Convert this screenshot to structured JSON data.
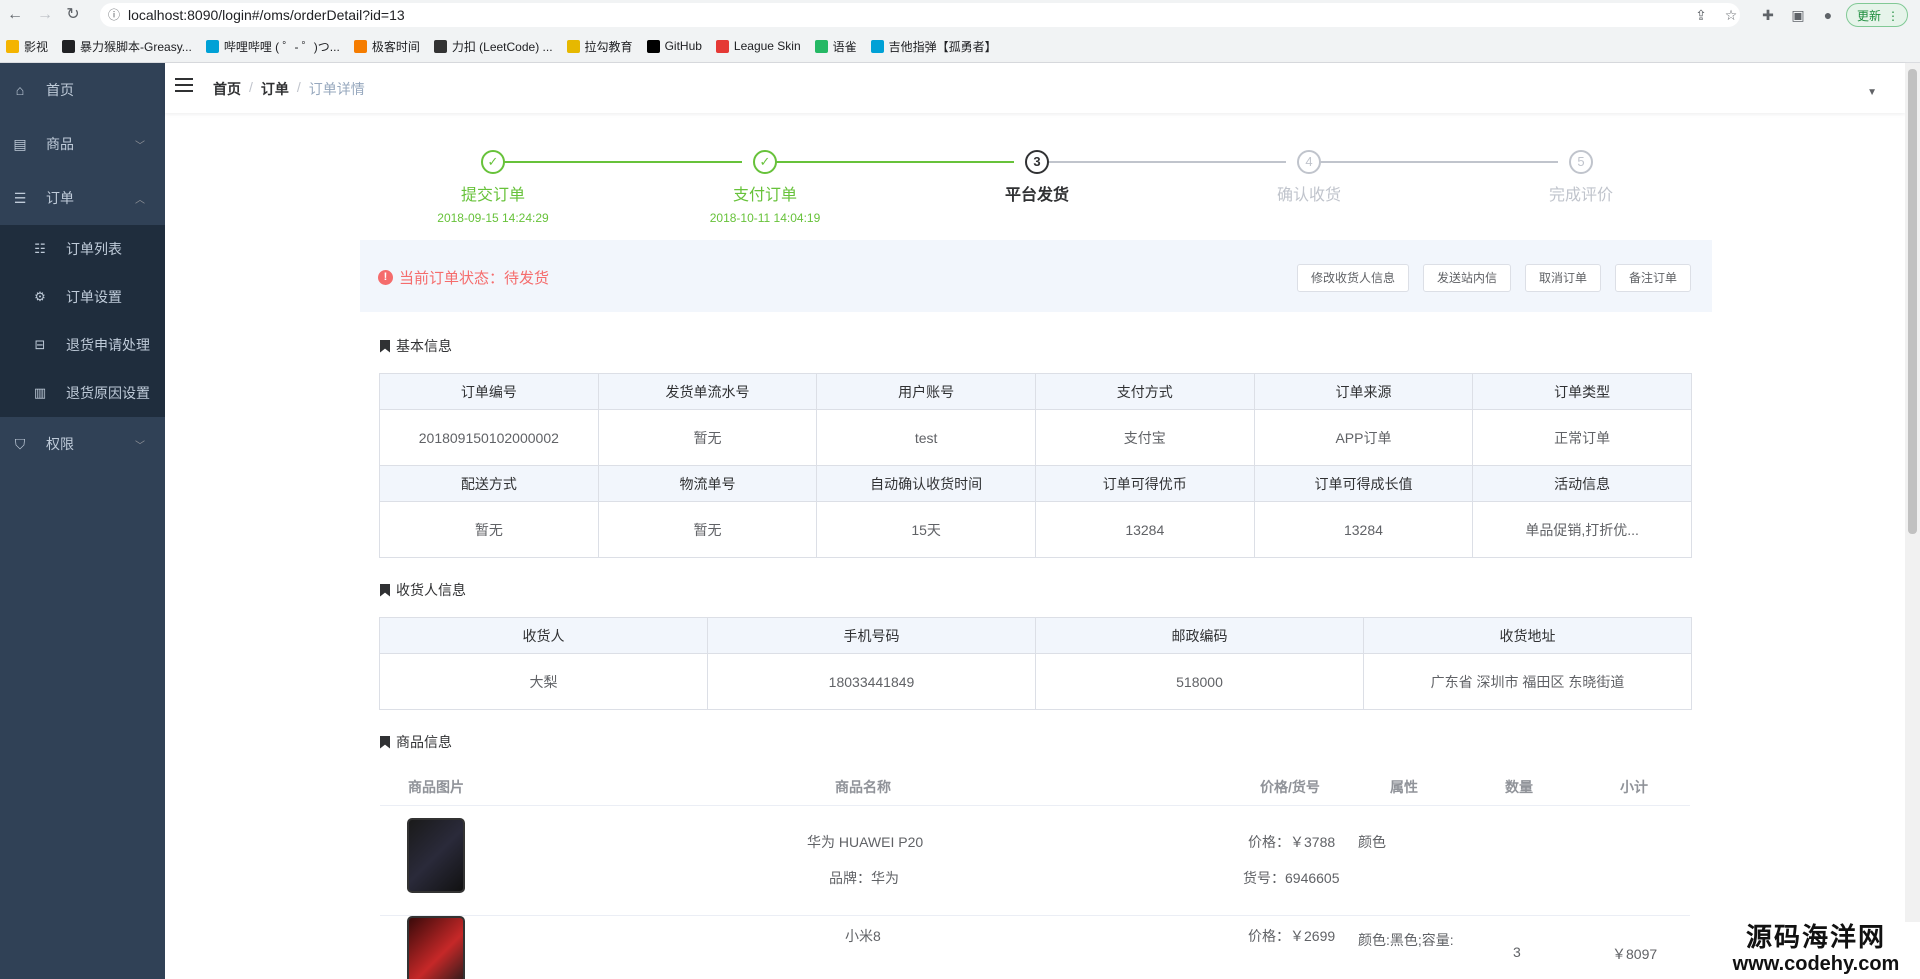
{
  "browser": {
    "url": "localhost:8090/login#/oms/orderDetail?id=13",
    "update_label": "更新",
    "bookmarks": [
      {
        "label": "影视",
        "color": "#f4b400"
      },
      {
        "label": "暴力猴脚本-Greasy...",
        "color": "#202124"
      },
      {
        "label": "哔哩哔哩 ( ゜- ゜)つ...",
        "color": "#00a1d6"
      },
      {
        "label": "极客时间",
        "color": "#f57c00"
      },
      {
        "label": "力扣 (LeetCode) ...",
        "color": "#333333"
      },
      {
        "label": "拉勾教育",
        "color": "#e6b800"
      },
      {
        "label": "GitHub",
        "color": "#000000"
      },
      {
        "label": "League Skin",
        "color": "#e53935"
      },
      {
        "label": "语雀",
        "color": "#25b864"
      },
      {
        "label": "吉他指弹【孤勇者】",
        "color": "#00a1d6"
      }
    ]
  },
  "sidebar": {
    "items": [
      {
        "label": "首页",
        "icon": "home-icon"
      },
      {
        "label": "商品",
        "icon": "goods-icon"
      },
      {
        "label": "订单",
        "icon": "order-icon"
      },
      {
        "label": "权限",
        "icon": "shield-icon"
      }
    ],
    "sub_items": [
      {
        "label": "订单列表",
        "icon": "list-icon"
      },
      {
        "label": "订单设置",
        "icon": "gear-icon"
      },
      {
        "label": "退货申请处理",
        "icon": "return-icon"
      },
      {
        "label": "退货原因设置",
        "icon": "reason-icon"
      }
    ]
  },
  "navbar": {
    "breadcrumb": [
      "首页",
      "订单",
      "订单详情"
    ]
  },
  "steps": [
    {
      "num": "✓",
      "title": "提交订单",
      "desc": "2018-09-15 14:24:29",
      "state": "done"
    },
    {
      "num": "✓",
      "title": "支付订单",
      "desc": "2018-10-11 14:04:19",
      "state": "done"
    },
    {
      "num": "3",
      "title": "平台发货",
      "desc": "",
      "state": "process"
    },
    {
      "num": "4",
      "title": "确认收货",
      "desc": "",
      "state": "wait"
    },
    {
      "num": "5",
      "title": "完成评价",
      "desc": "",
      "state": "wait"
    }
  ],
  "status": {
    "text": "当前订单状态：待发货",
    "buttons": [
      "修改收货人信息",
      "发送站内信",
      "取消订单",
      "备注订单"
    ]
  },
  "basic_info": {
    "title": "基本信息",
    "head1": [
      "订单编号",
      "发货单流水号",
      "用户账号",
      "支付方式",
      "订单来源",
      "订单类型"
    ],
    "row1": [
      "201809150102000002",
      "暂无",
      "test",
      "支付宝",
      "APP订单",
      "正常订单"
    ],
    "head2": [
      "配送方式",
      "物流单号",
      "自动确认收货时间",
      "订单可得优币",
      "订单可得成长值",
      "活动信息"
    ],
    "row2": [
      "暂无",
      "暂无",
      "15天",
      "13284",
      "13284",
      "单品促销,打折优..."
    ]
  },
  "receiver_info": {
    "title": "收货人信息",
    "head": [
      "收货人",
      "手机号码",
      "邮政编码",
      "收货地址"
    ],
    "row": [
      "大梨",
      "18033441849",
      "518000",
      "广东省 深圳市 福田区 东晓街道"
    ]
  },
  "goods_info": {
    "title": "商品信息",
    "head": [
      "商品图片",
      "商品名称",
      "价格/货号",
      "属性",
      "数量",
      "小计"
    ],
    "rows": [
      {
        "name": "华为 HUAWEI P20",
        "brand": "品牌：华为",
        "price": "价格：￥3788",
        "sn": "货号：6946605",
        "attr": "颜色",
        "qty": "",
        "subtotal": ""
      },
      {
        "name": "小米8",
        "brand": "",
        "price": "价格：￥2699",
        "sn": "",
        "attr": "颜色:黑色;容量:",
        "qty": "3",
        "subtotal": "￥8097"
      }
    ]
  },
  "watermark": {
    "cn": "源码海洋网",
    "en": "www.codehy.com"
  }
}
